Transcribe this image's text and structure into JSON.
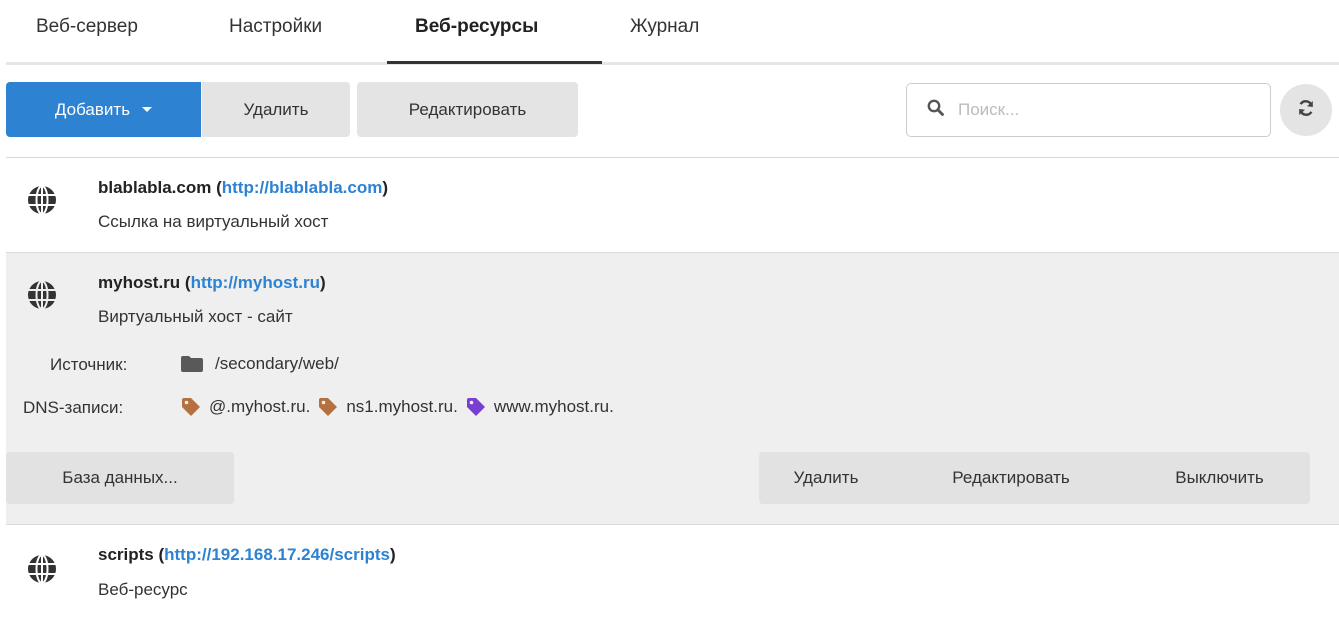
{
  "tabs": [
    {
      "label": "Веб-сервер"
    },
    {
      "label": "Настройки"
    },
    {
      "label": "Веб-ресурсы",
      "active": true
    },
    {
      "label": "Журнал"
    }
  ],
  "toolbar": {
    "add_label": "Добавить",
    "delete_label": "Удалить",
    "edit_label": "Редактировать",
    "search_placeholder": "Поиск...",
    "accent": "#2d82d2"
  },
  "resources": [
    {
      "name": "blablabla.com",
      "url": "http://blablabla.com",
      "type": "Ссылка на виртуальный хост",
      "icon": "globe-icon"
    },
    {
      "name": "myhost.ru",
      "url": "http://myhost.ru",
      "type": "Виртуальный хост - сайт",
      "icon": "globe-icon",
      "expanded": true,
      "source_label": "Источник:",
      "source_path": "/secondary/web/",
      "dns_label": "DNS-записи:",
      "dns": [
        {
          "name": "@.myhost.ru.",
          "color": "#b5703d"
        },
        {
          "name": "ns1.myhost.ru.",
          "color": "#b5703d"
        },
        {
          "name": "www.myhost.ru.",
          "color": "#7a3fd1"
        }
      ],
      "actions": {
        "database": "База данных...",
        "delete": "Удалить",
        "edit": "Редактировать",
        "disable": "Выключить"
      }
    },
    {
      "name": "scripts",
      "url": "http://192.168.17.246/scripts",
      "type": "Веб-ресурс",
      "icon": "globe-icon"
    }
  ]
}
